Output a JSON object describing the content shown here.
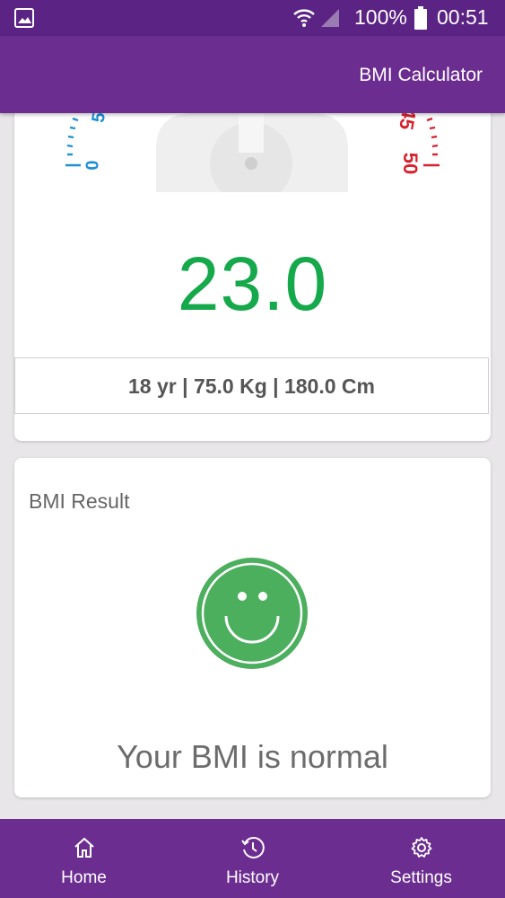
{
  "status_bar": {
    "battery": "100%",
    "time": "00:51",
    "icons": [
      "gallery-icon",
      "wifi-icon",
      "signal-icon",
      "battery-icon"
    ]
  },
  "app_bar": {
    "title": "BMI Calculator"
  },
  "gauge": {
    "left_scale_labels": [
      "0",
      "5"
    ],
    "right_scale_labels": [
      "45",
      "50"
    ],
    "left_color": "#1f8fd6",
    "right_color": "#d6212e"
  },
  "bmi": {
    "value": "23.0",
    "value_color": "#16a94c",
    "details": "18 yr | 75.0 Kg | 180.0 Cm"
  },
  "result": {
    "heading": "BMI Result",
    "message": "Your BMI is normal",
    "face_icon": "smiley-face-icon",
    "face_color": "#4caf5e"
  },
  "bottom_nav": {
    "items": [
      {
        "label": "Home",
        "icon": "home-icon"
      },
      {
        "label": "History",
        "icon": "history-icon"
      },
      {
        "label": "Settings",
        "icon": "settings-icon"
      }
    ]
  }
}
